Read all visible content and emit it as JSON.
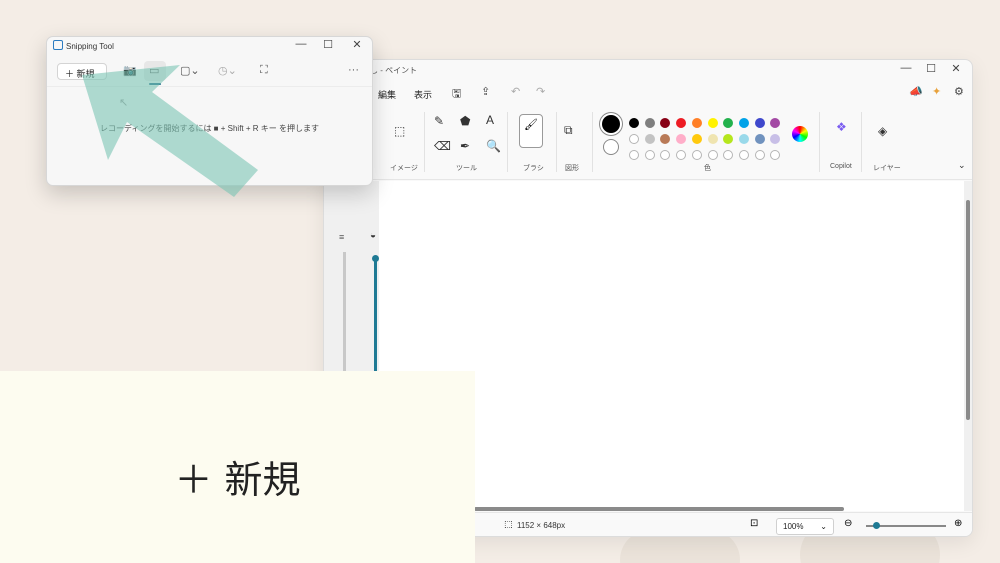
{
  "snipping_tool": {
    "title": "Snipping Tool",
    "new_button_label": "＋ 新規",
    "hint_text": "レコーディングを開始するには ■ + Shift + R キー を押します",
    "more_label": "···"
  },
  "paint": {
    "title": "し - ペイント",
    "menu": {
      "edit": "編集",
      "view": "表示"
    },
    "ribbon_labels": {
      "image": "イメージ",
      "tools": "ツール",
      "brush": "ブラシ",
      "shapes": "図形",
      "colors": "色",
      "copilot": "Copilot",
      "layers": "レイヤー"
    },
    "palette_row1": [
      "#000000",
      "#7f7f7f",
      "#880015",
      "#ed1c24",
      "#ff7f27",
      "#fff200",
      "#22b14c",
      "#00a2e8",
      "#3f48cc",
      "#a349a4"
    ],
    "palette_row2": [
      "",
      "#c3c3c3",
      "#b97a57",
      "#ffaec9",
      "#ffc90e",
      "#efe4b0",
      "#b5e61d",
      "#99d9ea",
      "#7092be",
      "#c8bfe7"
    ],
    "status": {
      "dimensions": "1152 × 648px",
      "zoom": "100%"
    }
  },
  "caption": {
    "text": "＋ 新規"
  },
  "colors": {
    "accent": "#1f7a94",
    "arrow": "#7cc4b4"
  }
}
